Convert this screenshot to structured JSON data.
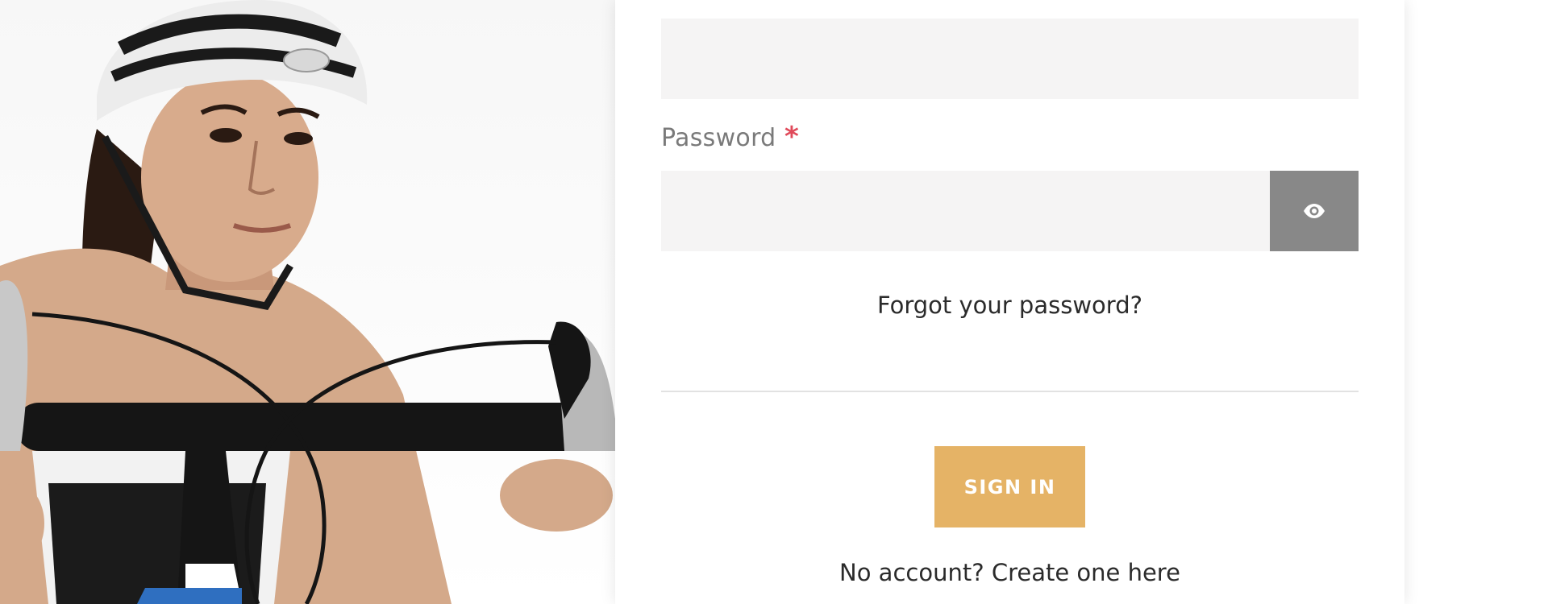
{
  "hero": {
    "image_subject": "cyclist-photo"
  },
  "login": {
    "password_label": "Password",
    "required_marker": "*",
    "reveal_icon": "eye-icon",
    "forgot_link": "Forgot your password?",
    "signin_button": "SIGN IN",
    "create_account_link": "No account? Create one here"
  },
  "colors": {
    "accent": "#e5b366",
    "input_bg": "#f5f4f4",
    "reveal_btn_bg": "#888888",
    "required": "#e04a5a"
  }
}
